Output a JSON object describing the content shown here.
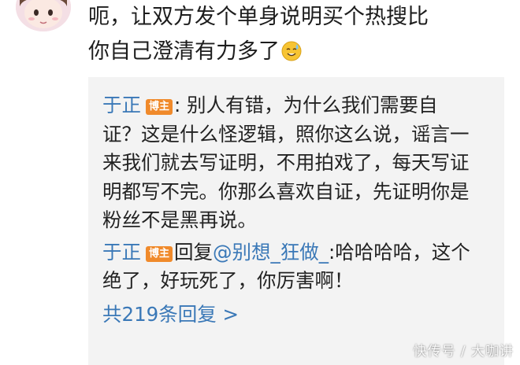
{
  "comment": {
    "line1": "呃，让双方发个单身说明买个热搜比",
    "line2": "你自己澄清有力多了",
    "emoji": "sweat-smile-icon"
  },
  "reply1": {
    "username": "于正",
    "badge": "博主",
    "text": ": 别人有错，为什么我们需要自证？这是什么怪逻辑，照你这么说，谣言一来我们就去写证明，不用拍戏了，每天写证明都写不完。你那么喜欢自证，先证明你是粉丝不是黑再说。"
  },
  "reply2": {
    "username": "于正",
    "badge": "博主",
    "reply_word": "回复",
    "mention": "@别想_狂做_",
    "text": ":哈哈哈哈，这个绝了，好玩死了，你厉害啊！"
  },
  "more_replies": "共219条回复 >",
  "watermark": "快传号 / 大咖讲",
  "colors": {
    "link": "#3a78b7",
    "badge": "#f08a2b",
    "reply_bg": "#f3f3f3"
  }
}
